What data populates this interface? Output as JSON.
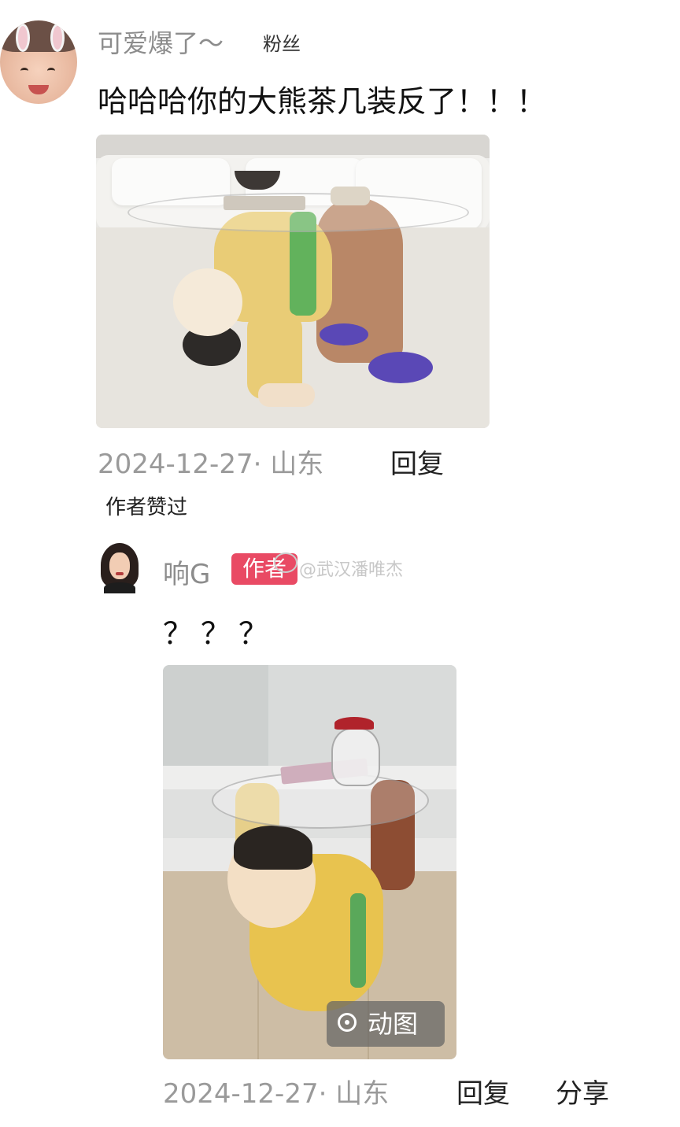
{
  "comment1": {
    "username": "可爱爆了～",
    "fan_label": "粉丝",
    "text": "哈哈哈你的大熊茶几装反了！！！",
    "image_icon": "photo-coffee-table-upside-down",
    "timestamp": "2024-12-27· 山东",
    "reply_label": "回复",
    "author_liked": "作者赞过"
  },
  "comment2": {
    "username": "响G",
    "author_badge": "作者",
    "watermark": "@武汉潘唯杰",
    "text": "？？？",
    "image_icon": "gif-coffee-table",
    "gif_badge": "动图",
    "timestamp": "2024-12-27· 山东",
    "reply_label": "回复",
    "share_label": "分享"
  }
}
